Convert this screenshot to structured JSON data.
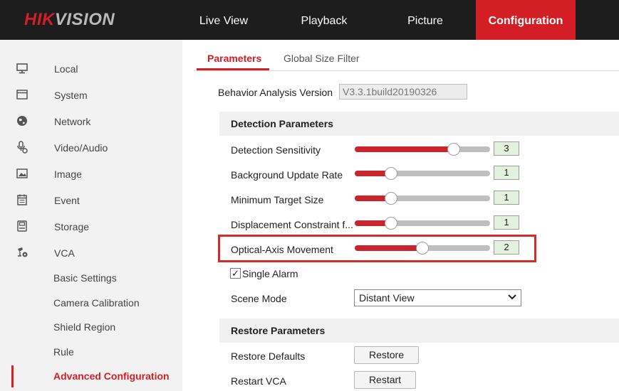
{
  "brand": {
    "logo_red": "HIK",
    "logo_grey": "VISION"
  },
  "nav": [
    {
      "label": "Live View"
    },
    {
      "label": "Playback"
    },
    {
      "label": "Picture"
    },
    {
      "label": "Configuration",
      "active": true
    }
  ],
  "sidebar": {
    "items": [
      {
        "label": "Local",
        "icon": "monitor-icon"
      },
      {
        "label": "System",
        "icon": "system-icon"
      },
      {
        "label": "Network",
        "icon": "globe-icon"
      },
      {
        "label": "Video/Audio",
        "icon": "video-audio-icon"
      },
      {
        "label": "Image",
        "icon": "image-icon"
      },
      {
        "label": "Event",
        "icon": "calendar-icon"
      },
      {
        "label": "Storage",
        "icon": "storage-icon"
      },
      {
        "label": "VCA",
        "icon": "vca-icon"
      }
    ],
    "vca_sub": [
      {
        "label": "Basic Settings"
      },
      {
        "label": "Camera Calibration"
      },
      {
        "label": "Shield Region"
      },
      {
        "label": "Rule"
      },
      {
        "label": "Advanced Configuration",
        "active": true
      }
    ]
  },
  "tabs": [
    {
      "label": "Parameters",
      "active": true
    },
    {
      "label": "Global Size Filter"
    }
  ],
  "version": {
    "label": "Behavior Analysis Version",
    "value": "V3.3.1build20190326"
  },
  "detection": {
    "heading": "Detection Parameters",
    "params": [
      {
        "label": "Detection Sensitivity",
        "value": "3",
        "level": 0.73
      },
      {
        "label": "Background Update Rate",
        "value": "1",
        "level": 0.27
      },
      {
        "label": "Minimum Target Size",
        "value": "1",
        "level": 0.27
      },
      {
        "label": "Displacement Constraint f...",
        "value": "1",
        "level": 0.27
      },
      {
        "label": "Optical-Axis Movement",
        "value": "2",
        "level": 0.5,
        "highlighted": true
      }
    ],
    "single_alarm": {
      "label": "Single Alarm",
      "checked": true,
      "mark": "✓"
    },
    "scene_mode": {
      "label": "Scene Mode",
      "value": "Distant View"
    }
  },
  "restore": {
    "heading": "Restore Parameters",
    "defaults_label": "Restore Defaults",
    "restore_button": "Restore",
    "restart_label": "Restart VCA",
    "restart_button": "Restart"
  },
  "colors": {
    "accent": "#d31e25",
    "topbar": "#1d1d1d",
    "value_box": "#e2f2df"
  }
}
